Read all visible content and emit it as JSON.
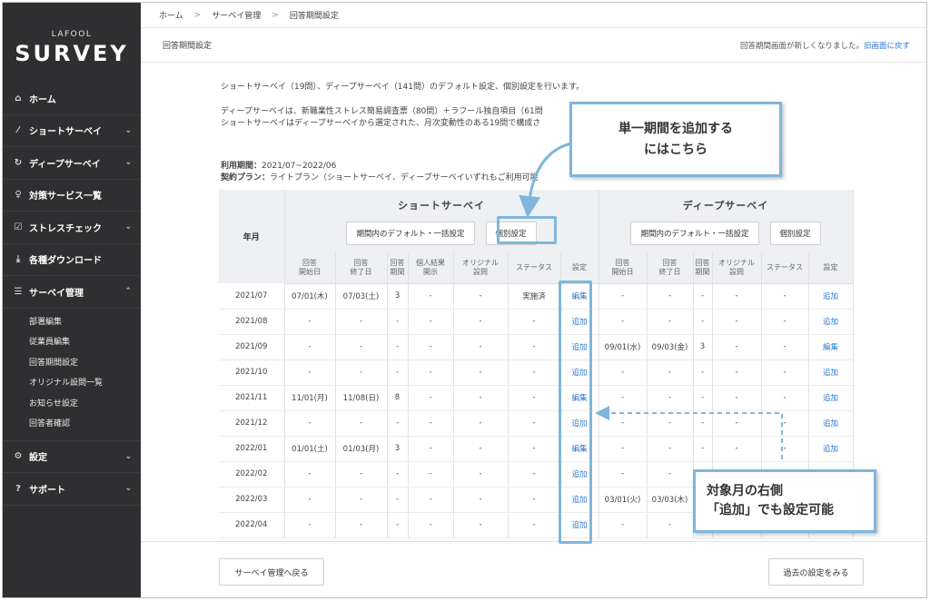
{
  "sidebar": {
    "logo_small": "LAFOOL",
    "logo_big": "SURVEY",
    "items": [
      {
        "icon": "⌂",
        "label": "ホーム",
        "chevron": ""
      },
      {
        "icon": "⁄",
        "label": "ショートサーベイ",
        "chevron": "⌄"
      },
      {
        "icon": "↻",
        "label": "ディープサーベイ",
        "chevron": "⌄"
      },
      {
        "icon": "♀",
        "label": "対策サービス一覧",
        "chevron": ""
      },
      {
        "icon": "☑",
        "label": "ストレスチェック",
        "chevron": "⌄"
      },
      {
        "icon": "⤓",
        "label": "各種ダウンロード",
        "chevron": ""
      },
      {
        "icon": "☰",
        "label": "サーベイ管理",
        "chevron": "⌃"
      }
    ],
    "sub_items": [
      "部署編集",
      "従業員編集",
      "回答期間設定",
      "オリジナル設問一覧",
      "お知らせ設定",
      "回答者確認"
    ],
    "bottom_items": [
      {
        "icon": "⚙",
        "label": "設定",
        "chevron": "⌄"
      },
      {
        "icon": "?",
        "label": "サポート",
        "chevron": "⌄"
      }
    ]
  },
  "breadcrumb": [
    "ホーム",
    "サーベイ管理",
    "回答期間設定"
  ],
  "breadcrumb_sep": ">",
  "page": {
    "title": "回答期間設定",
    "notice": "回答期間画面が新しくなりました。",
    "notice_link": "旧画面に戻す"
  },
  "description": {
    "line1": "ショートサーベイ（19問）、ディープサーベイ（141問）のデフォルト設定、個別設定を行います。",
    "line2": "ディープサーベイは、新職業性ストレス簡易調査票（80問）＋ラフール独自項目（61問",
    "line3": "ショートサーベイはディープサーベイから選定された、月次変動性のある19問で構成さ",
    "period_label": "利用期間：",
    "period_value": "2021/07~2022/06",
    "plan_label": "契約プラン：",
    "plan_value": "ライトプラン（ショートサーベイ、ディープサーベイいずれもご利用可能"
  },
  "table": {
    "ym_header": "年月",
    "short_title": "ショートサーベイ",
    "deep_title": "ディープサーベイ",
    "btn_default": "期間内のデフォルト・一括設定",
    "btn_individual": "個別設定",
    "sub_headers": [
      "回答\n開始日",
      "回答\n終了日",
      "回答\n期間",
      "個人結果\n開示",
      "オリジナル\n設問",
      "ステータス",
      "設定"
    ],
    "deep_sub_headers": [
      "回答\n開始日",
      "回答\n終了日",
      "回答\n期間",
      "オリジナル\n設問",
      "ステータス",
      "設定"
    ],
    "rows": [
      {
        "ym": "2021/07",
        "s": [
          "07/01(木)",
          "07/03(土)",
          "3",
          "-",
          "-",
          "実施済"
        ],
        "s_action": "編集",
        "d": [
          "-",
          "-",
          "-",
          "-",
          "-"
        ],
        "d_action": "追加"
      },
      {
        "ym": "2021/08",
        "s": [
          "-",
          "-",
          "-",
          "-",
          "-",
          "-"
        ],
        "s_action": "追加",
        "d": [
          "-",
          "-",
          "-",
          "-",
          "-"
        ],
        "d_action": "追加"
      },
      {
        "ym": "2021/09",
        "s": [
          "-",
          "-",
          "-",
          "-",
          "-",
          "-"
        ],
        "s_action": "追加",
        "d": [
          "09/01(水)",
          "09/03(金)",
          "3",
          "-",
          "-"
        ],
        "d_action": "編集"
      },
      {
        "ym": "2021/10",
        "s": [
          "-",
          "-",
          "-",
          "-",
          "-",
          "-"
        ],
        "s_action": "追加",
        "d": [
          "-",
          "-",
          "-",
          "-",
          "-"
        ],
        "d_action": "追加"
      },
      {
        "ym": "2021/11",
        "s": [
          "11/01(月)",
          "11/08(日)",
          "8",
          "-",
          "-",
          "-"
        ],
        "s_action": "編集",
        "d": [
          "-",
          "-",
          "-",
          "-",
          "-"
        ],
        "d_action": "追加"
      },
      {
        "ym": "2021/12",
        "s": [
          "-",
          "-",
          "-",
          "-",
          "-",
          "-"
        ],
        "s_action": "追加",
        "d": [
          "-",
          "-",
          "-",
          "-",
          "-"
        ],
        "d_action": "追加"
      },
      {
        "ym": "2022/01",
        "s": [
          "01/01(土)",
          "01/03(月)",
          "3",
          "-",
          "-",
          "-"
        ],
        "s_action": "編集",
        "d": [
          "-",
          "-",
          "-",
          "-",
          "-"
        ],
        "d_action": "追加"
      },
      {
        "ym": "2022/02",
        "s": [
          "-",
          "-",
          "-",
          "-",
          "-",
          "-"
        ],
        "s_action": "追加",
        "d": [
          "-",
          "-",
          "",
          "",
          ""
        ],
        "d_action": ""
      },
      {
        "ym": "2022/03",
        "s": [
          "-",
          "-",
          "-",
          "-",
          "-",
          "-"
        ],
        "s_action": "追加",
        "d": [
          "03/01(火)",
          "03/03(木)",
          "",
          "",
          ""
        ],
        "d_action": ""
      },
      {
        "ym": "2022/04",
        "s": [
          "-",
          "-",
          "-",
          "-",
          "-",
          "-"
        ],
        "s_action": "追加",
        "d": [
          "-",
          "-",
          "",
          "",
          ""
        ],
        "d_action": ""
      }
    ]
  },
  "footer": {
    "back_label": "サーベイ管理へ戻る",
    "past_label": "過去の設定をみる"
  },
  "callouts": {
    "top_line1": "単一期間を追加する",
    "top_line2": "にはこちら",
    "bottom_line1": "対象月の右側",
    "bottom_line2": "「追加」でも設定可能"
  },
  "colors": {
    "sidebar": "#2f2f31",
    "link": "#2b78d0",
    "callout_border": "#7eb6dd"
  }
}
